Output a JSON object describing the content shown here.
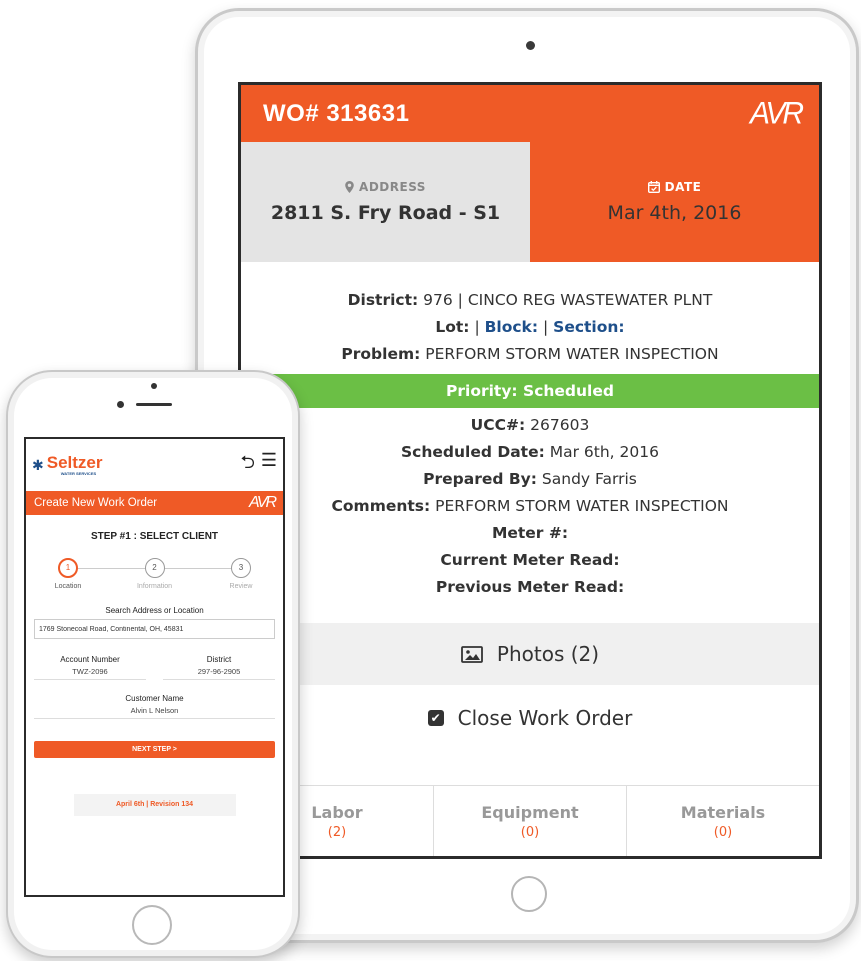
{
  "tablet": {
    "wo_number": "WO# 313631",
    "logo_text": "AVR",
    "address_label": "ADDRESS",
    "address_value": "2811 S. Fry Road - S1",
    "date_label": "DATE",
    "date_value": "Mar 4th, 2016",
    "district_label": "District:",
    "district_value": "976 | CINCO REG WASTEWATER PLNT",
    "lot_label": "Lot:",
    "block_label": "Block:",
    "section_label": "Section:",
    "problem_label": "Problem:",
    "problem_value": "PERFORM STORM WATER INSPECTION",
    "priority": "Priority: Scheduled",
    "ucc_label": "UCC#:",
    "ucc_value": "267603",
    "scheduled_label": "Scheduled Date:",
    "scheduled_value": "Mar 6th, 2016",
    "prepared_label": "Prepared By:",
    "prepared_value": "Sandy Farris",
    "comments_label": "Comments:",
    "comments_value": "PERFORM STORM WATER INSPECTION",
    "meter_label": "Meter #:",
    "current_meter_label": "Current Meter Read:",
    "previous_meter_label": "Previous Meter Read:",
    "photos_label": "Photos (2)",
    "close_label": "Close Work Order",
    "tabs": [
      {
        "label": "Labor",
        "count": "(2)"
      },
      {
        "label": "Equipment",
        "count": "(0)"
      },
      {
        "label": "Materials",
        "count": "(0)"
      }
    ],
    "accent_color": "#ef5a26",
    "priority_color": "#6bbf45"
  },
  "phone": {
    "brand_name": "Seltzer",
    "brand_sub": "WATER SERVICES",
    "bar_title": "Create New Work Order",
    "logo_text": "AVR",
    "step_title": "STEP #1 : SELECT CLIENT",
    "steps": [
      {
        "num": "1",
        "label": "Location"
      },
      {
        "num": "2",
        "label": "Information"
      },
      {
        "num": "3",
        "label": "Review"
      }
    ],
    "search_label": "Search Address or Location",
    "search_value": "1769 Stonecoal Road, Continental, OH, 45831",
    "account_label": "Account Number",
    "account_value": "TWZ-2096",
    "district_label": "District",
    "district_value": "297-96-2905",
    "customer_label": "Customer Name",
    "customer_value": "Alvin L Nelson",
    "next_button": "NEXT STEP >",
    "footer_stamp": "April 6th | Revision 134"
  }
}
